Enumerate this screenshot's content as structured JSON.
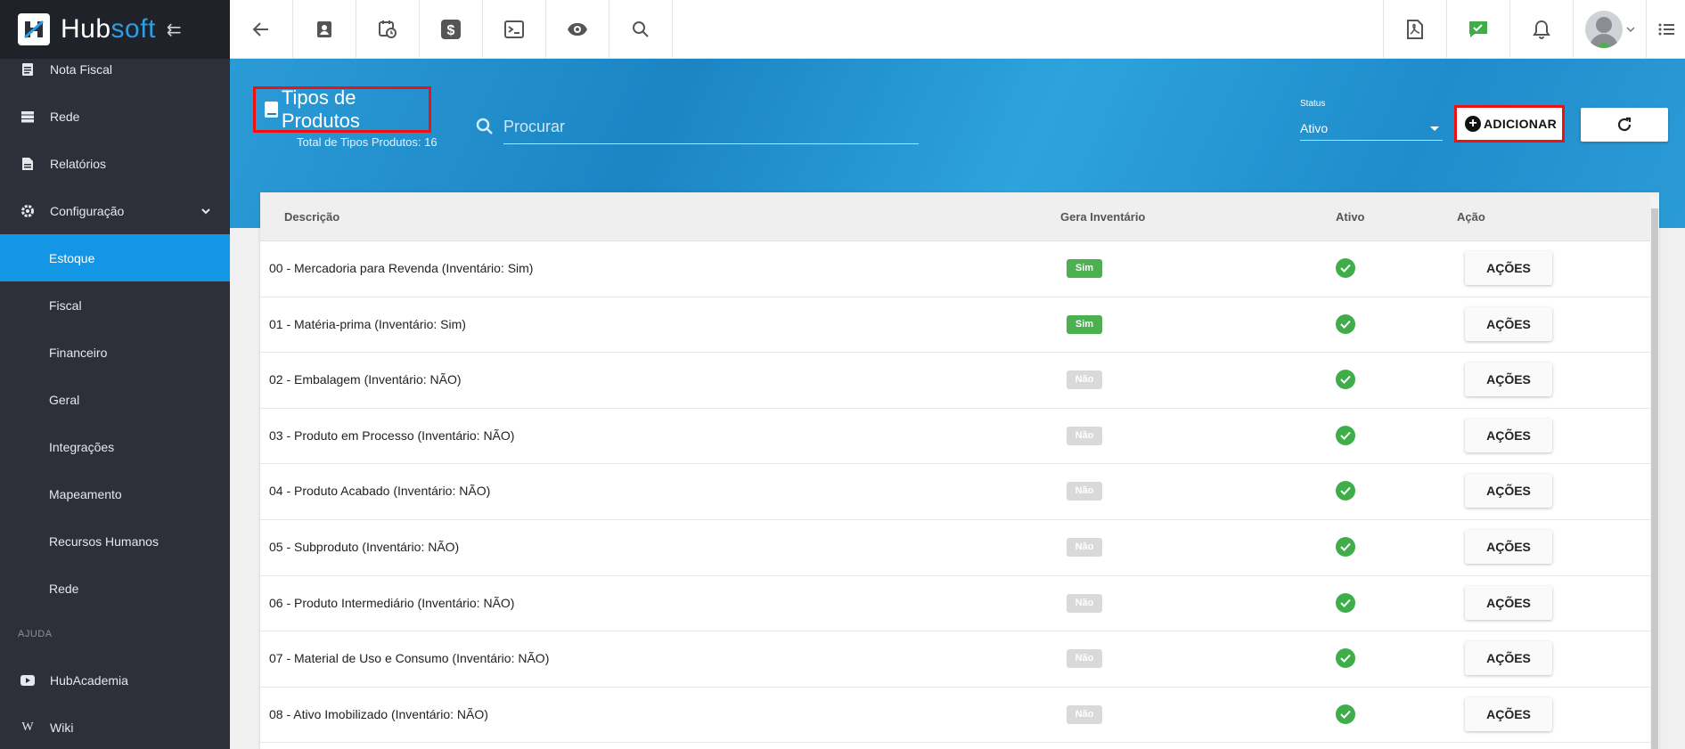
{
  "brand": {
    "name_part1": "Hub",
    "name_part2": "soft"
  },
  "sidebar": {
    "items": [
      {
        "label": "Nota Fiscal",
        "icon": "document-icon"
      },
      {
        "label": "Rede",
        "icon": "server-icon"
      },
      {
        "label": "Relatórios",
        "icon": "report-icon"
      },
      {
        "label": "Configuração",
        "icon": "gear-icon"
      },
      {
        "label": "Estoque",
        "active": true
      },
      {
        "label": "Fiscal"
      },
      {
        "label": "Financeiro"
      },
      {
        "label": "Geral"
      },
      {
        "label": "Integrações"
      },
      {
        "label": "Mapeamento"
      },
      {
        "label": "Recursos Humanos"
      },
      {
        "label": "Rede"
      }
    ],
    "section_help": "AJUDA",
    "help_items": [
      {
        "label": "HubAcademia",
        "icon": "youtube-icon"
      },
      {
        "label": "Wiki",
        "icon": "wiki-icon"
      }
    ]
  },
  "page": {
    "title": "Tipos de Produtos",
    "subtitle": "Total de Tipos Produtos: 16",
    "search_placeholder": "Procurar",
    "status_label": "Status",
    "status_value": "Ativo",
    "add_label": "ADICIONAR"
  },
  "table": {
    "headers": {
      "descricao": "Descrição",
      "gera": "Gera Inventário",
      "ativo": "Ativo",
      "acao": "Ação"
    },
    "rows": [
      {
        "desc": "00 - Mercadoria para Revenda (Inventário: Sim)",
        "gera": "Sim",
        "action": "AÇÕES"
      },
      {
        "desc": "01 - Matéria-prima (Inventário: Sim)",
        "gera": "Sim",
        "action": "AÇÕES"
      },
      {
        "desc": "02 - Embalagem (Inventário: NÃO)",
        "gera": "Não",
        "action": "AÇÕES"
      },
      {
        "desc": "03 - Produto em Processo (Inventário: NÃO)",
        "gera": "Não",
        "action": "AÇÕES"
      },
      {
        "desc": "04 - Produto Acabado (Inventário: NÃO)",
        "gera": "Não",
        "action": "AÇÕES"
      },
      {
        "desc": "05 - Subproduto (Inventário: NÃO)",
        "gera": "Não",
        "action": "AÇÕES"
      },
      {
        "desc": "06 - Produto Intermediário (Inventário: NÃO)",
        "gera": "Não",
        "action": "AÇÕES"
      },
      {
        "desc": "07 - Material de Uso e Consumo (Inventário: NÃO)",
        "gera": "Não",
        "action": "AÇÕES"
      },
      {
        "desc": "08 - Ativo Imobilizado (Inventário: NÃO)",
        "gera": "Não",
        "action": "AÇÕES"
      }
    ]
  },
  "colors": {
    "accent": "#1296e5",
    "sidebar": "#2d3038",
    "success": "#4caf50",
    "highlight_border": "#ee1111"
  }
}
